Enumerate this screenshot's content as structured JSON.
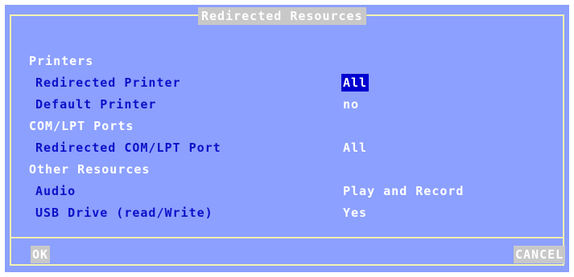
{
  "dialog": {
    "title": "Redirected Resources"
  },
  "sections": [
    {
      "label": "Printers",
      "items": [
        {
          "label": "Redirected Printer",
          "value": "All",
          "selected": true
        },
        {
          "label": "Default Printer",
          "value": "no"
        }
      ]
    },
    {
      "label": "COM/LPT Ports",
      "items": [
        {
          "label": "Redirected COM/LPT Port",
          "value": "All"
        }
      ]
    },
    {
      "label": "Other Resources",
      "items": [
        {
          "label": "Audio",
          "value": "Play and Record"
        },
        {
          "label": "USB Drive (read/Write)",
          "value": "Yes"
        }
      ]
    }
  ],
  "buttons": {
    "ok": "OK",
    "cancel": "CANCEL"
  },
  "colors": {
    "background": "#8ca0ff",
    "border": "#f4f4b0",
    "label": "#0b10c8",
    "selection": "#0000d0",
    "button": "#c8c8c8"
  }
}
